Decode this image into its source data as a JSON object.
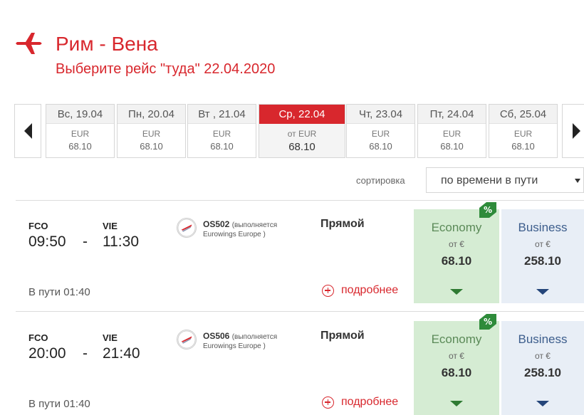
{
  "header": {
    "route": "Рим - Вена",
    "subtitle": "Выберите рейс \"туда\" 22.04.2020",
    "plane_icon": "plane-icon",
    "accent_color": "#d8272d"
  },
  "dates": [
    {
      "label": "Вс, 19.04",
      "currency": "EUR",
      "price": "68.10",
      "active": false
    },
    {
      "label": "Пн, 20.04",
      "currency": "EUR",
      "price": "68.10",
      "active": false
    },
    {
      "label": "Вт , 21.04",
      "currency": "EUR",
      "price": "68.10",
      "active": false
    },
    {
      "label": "Ср, 22.04",
      "currency": "от EUR",
      "price": "68.10",
      "active": true
    },
    {
      "label": "Чт, 23.04",
      "currency": "EUR",
      "price": "68.10",
      "active": false
    },
    {
      "label": "Пт, 24.04",
      "currency": "EUR",
      "price": "68.10",
      "active": false
    },
    {
      "label": "Сб, 25.04",
      "currency": "EUR",
      "price": "68.10",
      "active": false
    }
  ],
  "sort": {
    "label": "сортировка",
    "selected": "по времени в пути"
  },
  "flights": [
    {
      "from": "FCO",
      "to": "VIE",
      "dep": "09:50",
      "arr": "11:30",
      "dash": "-",
      "flight_no": "OS502",
      "operated_prefix": "(выполняется",
      "operator": "Eurowings Europe )",
      "stops": "Прямой",
      "duration": "В пути 01:40",
      "details": "подробнее",
      "economy": {
        "name": "Economy",
        "from": "от €",
        "price": "68.10",
        "discount": "%"
      },
      "business": {
        "name": "Business",
        "from": "от €",
        "price": "258.10"
      }
    },
    {
      "from": "FCO",
      "to": "VIE",
      "dep": "20:00",
      "arr": "21:40",
      "dash": "-",
      "flight_no": "OS506",
      "operated_prefix": "(выполняется",
      "operator": "Eurowings Europe )",
      "stops": "Прямой",
      "duration": "В пути 01:40",
      "details": "подробнее",
      "economy": {
        "name": "Economy",
        "from": "от €",
        "price": "68.10",
        "discount": "%"
      },
      "business": {
        "name": "Business",
        "from": "от €",
        "price": "258.10"
      }
    }
  ],
  "colors": {
    "economy_bg": "#d5ecd3",
    "business_bg": "#e8eef6",
    "discount_tag": "#2e8b3a"
  }
}
